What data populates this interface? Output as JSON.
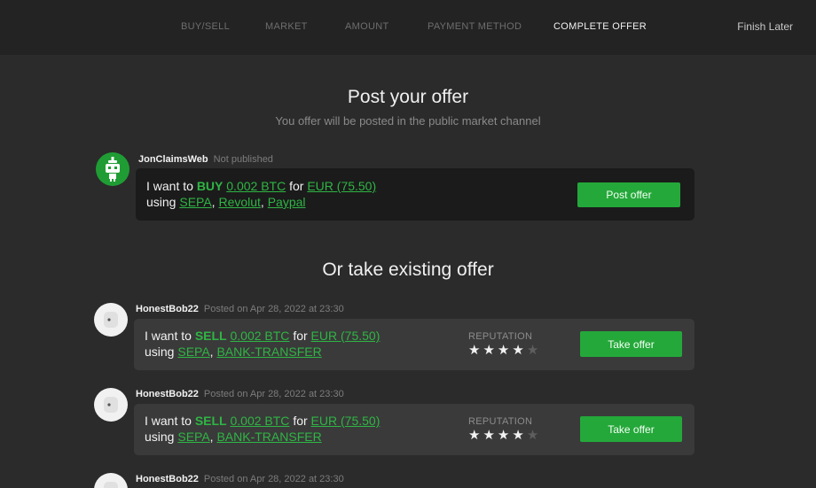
{
  "nav": {
    "steps": [
      "BUY/SELL",
      "MARKET",
      "AMOUNT",
      "PAYMENT METHOD",
      "COMPLETE OFFER"
    ],
    "active_step": "COMPLETE OFFER",
    "finish_later": "Finish Later"
  },
  "post_section": {
    "title": "Post your offer",
    "subtitle": "You offer will be posted in the public market channel"
  },
  "own_offer": {
    "username": "JonClaimsWeb",
    "status": "Not published",
    "avatar_icon": "robot-avatar-icon",
    "text_i_want_to": "I want to",
    "action": "BUY",
    "amount": "0.002 BTC",
    "text_for": "for",
    "fiat": "EUR (75.50)",
    "text_using": "using",
    "methods": [
      "SEPA",
      "Revolut",
      "Paypal"
    ],
    "button": "Post offer"
  },
  "existing_section": {
    "title": "Or take existing offer"
  },
  "offers": [
    {
      "username": "HonestBob22",
      "posted": "Posted on Apr 28, 2022 at 23:30",
      "text_i_want_to": "I want to",
      "action": "SELL",
      "amount": "0.002 BTC",
      "text_for": "for",
      "fiat": "EUR (75.50)",
      "text_using": "using",
      "methods": [
        "SEPA",
        "BANK-TRANSFER"
      ],
      "reputation_label": "REPUTATION",
      "rating": 4,
      "rating_max": 5,
      "button": "Take offer"
    },
    {
      "username": "HonestBob22",
      "posted": "Posted on Apr 28, 2022 at 23:30",
      "text_i_want_to": "I want to",
      "action": "SELL",
      "amount": "0.002 BTC",
      "text_for": "for",
      "fiat": "EUR (75.50)",
      "text_using": "using",
      "methods": [
        "SEPA",
        "BANK-TRANSFER"
      ],
      "reputation_label": "REPUTATION",
      "rating": 4,
      "rating_max": 5,
      "button": "Take offer"
    },
    {
      "username": "HonestBob22",
      "posted": "Posted on Apr 28, 2022 at 23:30"
    }
  ],
  "colors": {
    "background": "#2b2b2b",
    "topbar": "#232323",
    "accent_green": "#2fb544",
    "button_green": "#24a83a",
    "own_card": "#1b1b1b",
    "offer_card": "#3a3a3a"
  }
}
